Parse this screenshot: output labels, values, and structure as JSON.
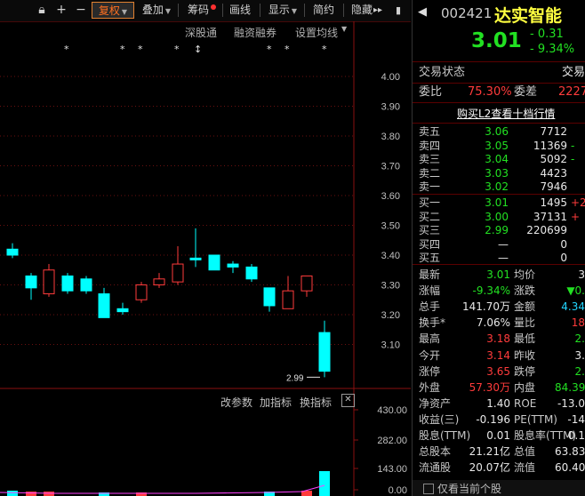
{
  "toolbar": {
    "fuquan": "复权",
    "diejia": "叠加",
    "chouma": "筹码",
    "huaxian": "画线",
    "xianshi": "显示",
    "jianyue": "简约",
    "yincang": "隐藏"
  },
  "chart": {
    "top_links": [
      "深股通",
      "融资融券",
      "设置均线"
    ],
    "y_labels": [
      "4.00",
      "3.90",
      "3.80",
      "3.70",
      "3.60",
      "3.50",
      "3.40",
      "3.30",
      "3.20",
      "3.10"
    ],
    "low_marker": "2.99",
    "sub_links": [
      "改参数",
      "加指标",
      "换指标"
    ],
    "vol_labels": [
      "430.00",
      "282.00",
      "143.00",
      "0.00"
    ],
    "candles": [
      {
        "o": 3.42,
        "c": 3.4,
        "h": 3.44,
        "l": 3.39
      },
      {
        "o": 3.33,
        "c": 3.29,
        "h": 3.34,
        "l": 3.25
      },
      {
        "o": 3.27,
        "c": 3.35,
        "h": 3.37,
        "l": 3.26
      },
      {
        "o": 3.33,
        "c": 3.28,
        "h": 3.34,
        "l": 3.27
      },
      {
        "o": 3.32,
        "c": 3.28,
        "h": 3.33,
        "l": 3.27
      },
      {
        "o": 3.27,
        "c": 3.19,
        "h": 3.29,
        "l": 3.19
      },
      {
        "o": 3.22,
        "c": 3.21,
        "h": 3.24,
        "l": 3.2
      },
      {
        "o": 3.25,
        "c": 3.3,
        "h": 3.31,
        "l": 3.24
      },
      {
        "o": 3.3,
        "c": 3.32,
        "h": 3.34,
        "l": 3.29
      },
      {
        "o": 3.31,
        "c": 3.37,
        "h": 3.43,
        "l": 3.3
      },
      {
        "o": 3.39,
        "c": 3.39,
        "h": 3.49,
        "l": 3.36
      },
      {
        "o": 3.4,
        "c": 3.35,
        "h": 3.4,
        "l": 3.35
      },
      {
        "o": 3.37,
        "c": 3.36,
        "h": 3.38,
        "l": 3.34
      },
      {
        "o": 3.36,
        "c": 3.32,
        "h": 3.37,
        "l": 3.31
      },
      {
        "o": 3.29,
        "c": 3.23,
        "h": 3.29,
        "l": 3.21
      },
      {
        "o": 3.22,
        "c": 3.28,
        "h": 3.33,
        "l": 3.22
      },
      {
        "o": 3.28,
        "c": 3.33,
        "h": 3.33,
        "l": 3.26
      },
      {
        "o": 3.14,
        "c": 3.01,
        "h": 3.18,
        "l": 2.99
      }
    ]
  },
  "quote": {
    "code": "002421",
    "name": "达实智能",
    "price": "3.01",
    "change": "- 0.31",
    "change_pct": "- 9.34%",
    "status_label": "交易状态",
    "status_value": "交易",
    "weibi_label": "委比",
    "weibi_value": "75.30%",
    "weicha_label": "委差",
    "weicha_value": "2227",
    "l2_link": "购买L2查看十档行情",
    "asks": [
      {
        "label": "卖五",
        "price": "3.06",
        "vol": "7712",
        "chg": ""
      },
      {
        "label": "卖四",
        "price": "3.05",
        "vol": "11369",
        "chg": "-"
      },
      {
        "label": "卖三",
        "price": "3.04",
        "vol": "5092",
        "chg": "-"
      },
      {
        "label": "卖二",
        "price": "3.03",
        "vol": "4423",
        "chg": ""
      },
      {
        "label": "卖一",
        "price": "3.02",
        "vol": "7946",
        "chg": ""
      }
    ],
    "bids": [
      {
        "label": "买一",
        "price": "3.01",
        "vol": "1495",
        "chg": "+2"
      },
      {
        "label": "买二",
        "price": "3.00",
        "vol": "37131",
        "chg": "+"
      },
      {
        "label": "买三",
        "price": "2.99",
        "vol": "220699",
        "chg": ""
      },
      {
        "label": "买四",
        "price": "—",
        "vol": "0",
        "chg": ""
      },
      {
        "label": "买五",
        "price": "—",
        "vol": "0",
        "chg": ""
      }
    ],
    "stats": [
      {
        "l1": "最新",
        "v1": "3.01",
        "c1": "green",
        "l2": "均价",
        "v2": "3",
        "c2": "white"
      },
      {
        "l1": "涨幅",
        "v1": "-9.34%",
        "c1": "green",
        "l2": "涨跌",
        "v2": "▼0.",
        "c2": "green"
      },
      {
        "l1": "总手",
        "v1": "141.70万",
        "c1": "white",
        "l2": "金额",
        "v2": "4.34",
        "c2": "cyan"
      },
      {
        "l1": "换手*",
        "v1": "7.06%",
        "c1": "white",
        "l2": "量比",
        "v2": "18",
        "c2": "red"
      },
      {
        "l1": "最高",
        "v1": "3.18",
        "c1": "red",
        "l2": "最低",
        "v2": "2.",
        "c2": "green"
      },
      {
        "l1": "今开",
        "v1": "3.14",
        "c1": "red",
        "l2": "昨收",
        "v2": "3.",
        "c2": "white"
      },
      {
        "l1": "涨停",
        "v1": "3.65",
        "c1": "red",
        "l2": "跌停",
        "v2": "2.",
        "c2": "green"
      },
      {
        "l1": "外盘",
        "v1": "57.30万",
        "c1": "red",
        "l2": "内盘",
        "v2": "84.39",
        "c2": "green"
      },
      {
        "l1": "净资产",
        "v1": "1.40",
        "c1": "white",
        "l2": "ROE",
        "v2": "-13.0",
        "c2": "white"
      },
      {
        "l1": "收益(三)",
        "v1": "-0.196",
        "c1": "white",
        "l2": "PE(TTM)",
        "v2": "-14",
        "c2": "white"
      },
      {
        "l1": "股息(TTM)",
        "v1": "0.01",
        "c1": "white",
        "l2": "股息率(TTM)",
        "v2": "0.1",
        "c2": "white"
      },
      {
        "l1": "总股本",
        "v1": "21.21亿",
        "c1": "white",
        "l2": "总值",
        "v2": "63.83",
        "c2": "white"
      },
      {
        "l1": "流通股",
        "v1": "20.07亿",
        "c1": "white",
        "l2": "流值",
        "v2": "60.40",
        "c2": "white"
      }
    ],
    "only_current": "仅看当前个股"
  },
  "colors": {
    "up": "#ff3b3b",
    "down": "#00ffff",
    "green": "#22e022",
    "bg": "#000000"
  }
}
